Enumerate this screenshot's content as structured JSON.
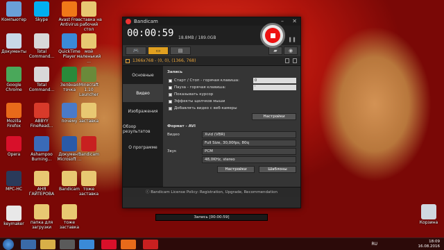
{
  "desktop_icons": [
    {
      "label": "Компьютер",
      "color": "#6aa0d8"
    },
    {
      "label": "Skype",
      "color": "#00aff0"
    },
    {
      "label": "Avast Free Antivirus",
      "color": "#f07818"
    },
    {
      "label": "заставка на рабочий стол",
      "color": "#e8c872"
    },
    {
      "label": "Документы",
      "color": "#c8d8e8"
    },
    {
      "label": "Total Command...",
      "color": "#d8d8d8"
    },
    {
      "label": "QuickTime Player",
      "color": "#3a8ad8"
    },
    {
      "label": "мой маленький ...",
      "color": "#e8c872"
    },
    {
      "label": "Google Chrome",
      "color": "#4aa85a"
    },
    {
      "label": "Total Command...",
      "color": "#d8d8d8"
    },
    {
      "label": "Зелёная точка",
      "color": "#2a8a3a"
    },
    {
      "label": "Minecraft 1.10 Launcher",
      "color": "#6a8a3a"
    },
    {
      "label": "Mozilla Firefox",
      "color": "#e86a1a"
    },
    {
      "label": "ABBYY FineRead...",
      "color": "#d83a2a"
    },
    {
      "label": "почему",
      "color": "#4a7ac8"
    },
    {
      "label": "заставка",
      "color": "#e8c872"
    },
    {
      "label": "Opera",
      "color": "#d8102a"
    },
    {
      "label": "Ashampoo Burning...",
      "color": "#3a6ab8"
    },
    {
      "label": "Документ Microsoft ...",
      "color": "#2a5aa8"
    },
    {
      "label": "Bandicam",
      "color": "#c82020"
    },
    {
      "label": "МРС-НС",
      "color": "#2a3a5a"
    },
    {
      "label": "АНЯ ГАЙТЕРОВА",
      "color": "#e8c872"
    },
    {
      "label": "Bandicam",
      "color": "#e8c872"
    },
    {
      "label": "тоже заставка",
      "color": "#e8c872"
    },
    {
      "label": "keymaker",
      "color": "#e8e8e8"
    },
    {
      "label": "папка для загрузки",
      "color": "#e8c872"
    },
    {
      "label": "тоже заставка",
      "color": "#e8c872"
    },
    {
      "label": "Корзина",
      "color": "#d0d8e0"
    }
  ],
  "window": {
    "title": "Bandicam",
    "timer": "00:00:59",
    "size": "18.8MB / 189.0GB",
    "resolution": "1366x768 - (0, 0), (1366, 768)",
    "sidebar": [
      "Основные",
      "Видео",
      "Изображения",
      "Обзор результатов",
      "О программе"
    ],
    "record": {
      "section": "Запись",
      "rows": [
        {
          "label": "Старт / Стоп - горячая клавиша:",
          "checked": true,
          "value": "0"
        },
        {
          "label": "Пауза - горячая клавиша:",
          "checked": true,
          "value": "'"
        },
        {
          "label": "Показывать курсор",
          "checked": false,
          "value": ""
        },
        {
          "label": "Эффекты щелчков мыши",
          "checked": true,
          "value": ""
        },
        {
          "label": "Добавлять видео с веб-камеры",
          "checked": false,
          "value": ""
        }
      ],
      "settings_button": "Настройки"
    },
    "format": {
      "section": "Формат - AVI",
      "video_label": "Видео",
      "video_codec": "Xvid (VBR)",
      "video_detail": "Full Size, 30,00fps, 80q",
      "audio_label": "Звук",
      "audio_codec": "PCM",
      "audio_detail": "48,0KHz, stereo",
      "settings_button": "Настройки",
      "templates_button": "Шаблоны"
    },
    "footer": "Bandicam License Policy: Registration, Upgrade, Recommendation"
  },
  "rec_strip": "Запись [00:00:59]",
  "taskbar": {
    "lang": "RU",
    "time": "18:09",
    "date": "16.08.2016"
  }
}
